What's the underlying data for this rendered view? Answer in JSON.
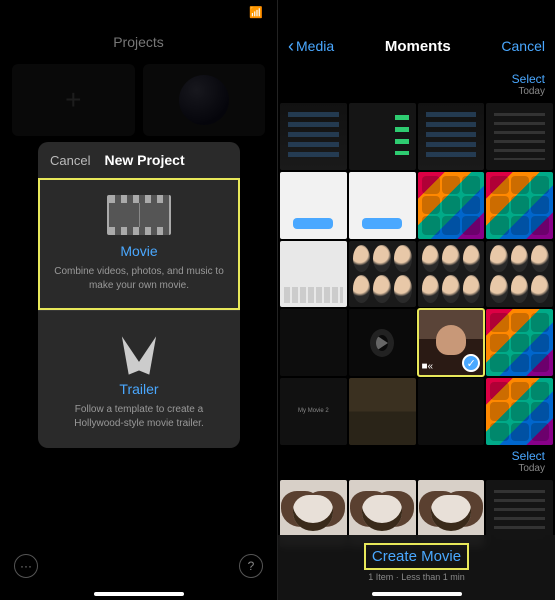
{
  "left": {
    "status_time": "",
    "projects_header": "Projects",
    "modal": {
      "cancel": "Cancel",
      "title": "New Project",
      "movie": {
        "title": "Movie",
        "desc": "Combine videos, photos, and music to make your own movie."
      },
      "trailer": {
        "title": "Trailer",
        "desc": "Follow a template to create a Hollywood-style movie trailer."
      }
    },
    "more": "···",
    "help": "?"
  },
  "right": {
    "nav": {
      "back": "Media",
      "title": "Moments",
      "cancel": "Cancel"
    },
    "section1": {
      "select": "Select",
      "day": "Today"
    },
    "section2": {
      "select": "Select",
      "day": "Today"
    },
    "my_movie": "My Movie 2",
    "create": {
      "label": "Create Movie",
      "sub": "1 Item · Less than 1 min"
    }
  }
}
